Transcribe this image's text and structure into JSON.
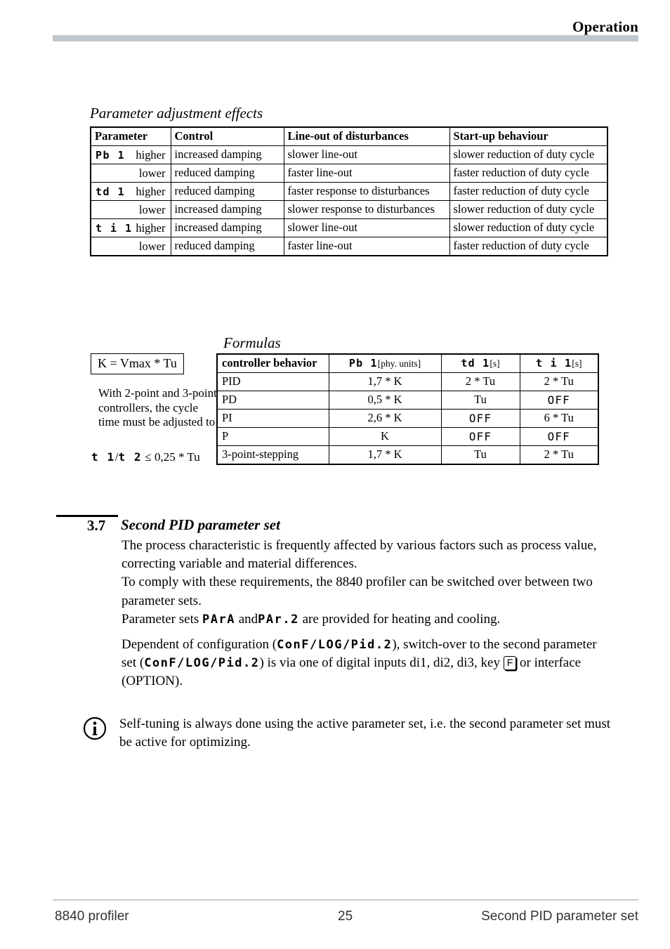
{
  "header": {
    "title": "Operation"
  },
  "effects": {
    "caption": "Parameter adjustment effects",
    "columns": [
      "Parameter",
      "Control",
      "Line-out of disturbances",
      "Start-up behaviour"
    ],
    "rows": [
      {
        "code": "Pb 1",
        "direction": "higher",
        "control": "increased damping",
        "lineout": "slower line-out",
        "startup": "slower reduction of duty cycle"
      },
      {
        "code": "",
        "direction": "lower",
        "control": "reduced damping",
        "lineout": "faster line-out",
        "startup": "faster reduction of duty cycle"
      },
      {
        "code": "td 1",
        "direction": "higher",
        "control": "reduced damping",
        "lineout": "faster response to disturbances",
        "startup": "faster reduction of duty cycle"
      },
      {
        "code": "",
        "direction": "lower",
        "control": "increased damping",
        "lineout": "slower response to disturbances",
        "startup": "slower reduction of duty cycle"
      },
      {
        "code": "t i 1",
        "direction": "higher",
        "control": "increased damping",
        "lineout": "slower line-out",
        "startup": "slower reduction of duty cycle"
      },
      {
        "code": "",
        "direction": "lower",
        "control": "reduced damping",
        "lineout": "faster line-out",
        "startup": "faster reduction of duty cycle"
      }
    ]
  },
  "kbox": {
    "formula": "K = Vmax * Tu"
  },
  "cycle_note": {
    "text": "With 2-point and 3-point controllers, the cycle time must be adjusted to",
    "code_a": "t 1",
    "separator": "/",
    "code_b": "t 2",
    "condition": "≤ 0,25 * Tu"
  },
  "formulas": {
    "caption": "Formulas",
    "columns": [
      {
        "label": "controller behavior",
        "code": "",
        "unit": ""
      },
      {
        "label": "",
        "code": "Pb 1",
        "unit": "[phy. units]"
      },
      {
        "label": "",
        "code": "td 1",
        "unit": "[s]"
      },
      {
        "label": "",
        "code": "t i 1",
        "unit": "[s]"
      }
    ],
    "rows": [
      {
        "behavior": "PID",
        "pb": "1,7 * K",
        "td": "2 * Tu",
        "ti": "2 * Tu",
        "td_seg": false,
        "ti_seg": false
      },
      {
        "behavior": "PD",
        "pb": "0,5 * K",
        "td": "Tu",
        "ti": "OFF",
        "td_seg": false,
        "ti_seg": true
      },
      {
        "behavior": "PI",
        "pb": "2,6 * K",
        "td": "OFF",
        "ti": "6 * Tu",
        "td_seg": true,
        "ti_seg": false
      },
      {
        "behavior": "P",
        "pb": "K",
        "td": "OFF",
        "ti": "OFF",
        "td_seg": true,
        "ti_seg": true
      },
      {
        "behavior": "3-point-stepping",
        "pb": "1,7 * K",
        "td": "Tu",
        "ti": "2 * Tu",
        "td_seg": false,
        "ti_seg": false
      }
    ]
  },
  "section": {
    "number": "3.7",
    "title": "Second PID parameter set",
    "para1_a": "The process characteristic is frequently affected by  various factors such as process value, correcting variable and material differences.",
    "para1_b": "To comply with these requirements, the 8840 profiler can be switched over between two parameter sets.",
    "para1_c_pre": "Parameter sets",
    "para1_code1": "PArA",
    "para1_c_mid": "and",
    "para1_code2": "PAr.2",
    "para1_c_post": "are provided for heating and cooling.",
    "para2_pre": "Dependent of configuration (",
    "para2_code1": "ConF/LOG/Pid.2",
    "para2_mid": "), switch-over to the second parameter set  (",
    "para2_code2": "ConF/LOG/Pid.2",
    "para2_post": ") is via one of digital inputs di1, di2, di3, key",
    "para2_key": "F",
    "para2_end": "or interface (OPTION)."
  },
  "info_note": {
    "icon": "info-icon",
    "text": "Self-tuning is always done using the active parameter set, i.e. the second parameter set must be active for optimizing."
  },
  "footer": {
    "left": "8840 profiler",
    "page": "25",
    "right": "Second PID parameter set"
  }
}
